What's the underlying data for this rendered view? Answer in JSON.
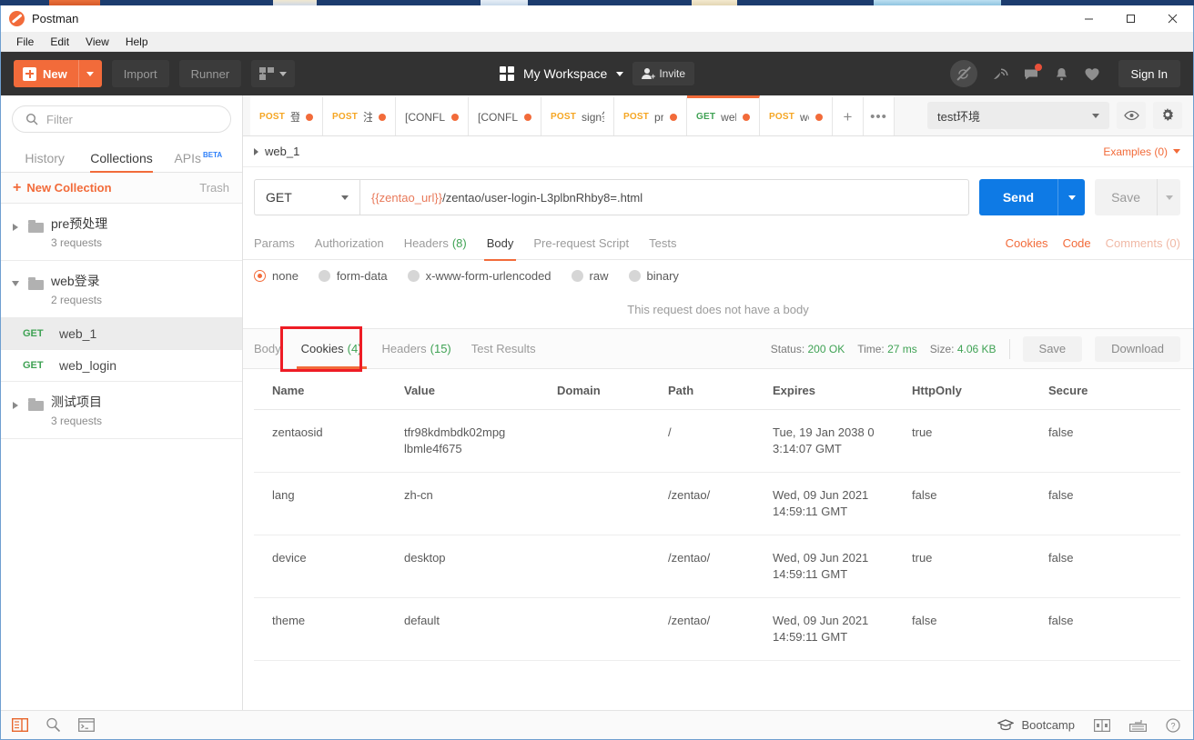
{
  "window": {
    "title": "Postman",
    "controls": {
      "minimize": "minimize-icon",
      "maximize": "maximize-icon",
      "close": "close-icon"
    }
  },
  "menubar": {
    "items": [
      "File",
      "Edit",
      "View",
      "Help"
    ]
  },
  "toolbar": {
    "new_label": "New",
    "import_label": "Import",
    "runner_label": "Runner",
    "workspace_label": "My Workspace",
    "invite_label": "Invite",
    "signin_label": "Sign In",
    "accent": "#f26b3a"
  },
  "sidebar": {
    "filter_placeholder": "Filter",
    "tabs": [
      {
        "label": "History",
        "active": false
      },
      {
        "label": "Collections",
        "active": true
      },
      {
        "label": "APIs",
        "badge": "BETA",
        "active": false
      }
    ],
    "new_collection_label": "New Collection",
    "trash_label": "Trash",
    "collections": [
      {
        "name": "pre预处理",
        "count": "3 requests",
        "expanded": false
      },
      {
        "name": "web登录",
        "count": "2 requests",
        "expanded": true
      },
      {
        "name": "测试项目",
        "count": "3 requests",
        "expanded": false
      }
    ],
    "requests": [
      {
        "method": "GET",
        "name": "web_1",
        "selected": true
      },
      {
        "method": "GET",
        "name": "web_login",
        "selected": false
      }
    ]
  },
  "request_tabs": {
    "items": [
      {
        "method": "POST",
        "name": "登录",
        "dirty": true,
        "active": false
      },
      {
        "method": "POST",
        "name": "注册",
        "dirty": true,
        "active": false
      },
      {
        "method": "",
        "name": "[CONFLIC",
        "dirty": true,
        "active": false
      },
      {
        "method": "",
        "name": "[CONFLIC",
        "dirty": true,
        "active": false
      },
      {
        "method": "POST",
        "name": "sign签名",
        "dirty": false,
        "active": false
      },
      {
        "method": "POST",
        "name": "pre",
        "dirty": true,
        "active": false
      },
      {
        "method": "GET",
        "name": "web_",
        "dirty": true,
        "active": true
      },
      {
        "method": "POST",
        "name": "wet",
        "dirty": true,
        "active": false
      }
    ],
    "add_label": "+",
    "more_label": "•••"
  },
  "environment": {
    "selected": "test环境",
    "eye_icon": "eye-icon",
    "gear_icon": "gear-icon"
  },
  "request": {
    "title": "web_1",
    "examples_label": "Examples (0)",
    "method": "GET",
    "url_variable": "{{zentao_url}}",
    "url_rest": "/zentao/user-login-L3plbnRhby8=.html",
    "send_label": "Send",
    "save_label": "Save",
    "tabs": [
      {
        "label": "Params",
        "count": "",
        "active": false
      },
      {
        "label": "Authorization",
        "count": "",
        "active": false
      },
      {
        "label": "Headers",
        "count": "(8)",
        "active": false
      },
      {
        "label": "Body",
        "count": "",
        "active": true
      },
      {
        "label": "Pre-request Script",
        "count": "",
        "active": false
      },
      {
        "label": "Tests",
        "count": "",
        "active": false
      }
    ],
    "links": [
      {
        "label": "Cookies",
        "muted": false
      },
      {
        "label": "Code",
        "muted": false
      },
      {
        "label": "Comments (0)",
        "muted": true
      }
    ],
    "body_types": [
      {
        "label": "none",
        "selected": true
      },
      {
        "label": "form-data",
        "selected": false
      },
      {
        "label": "x-www-form-urlencoded",
        "selected": false
      },
      {
        "label": "raw",
        "selected": false
      },
      {
        "label": "binary",
        "selected": false
      }
    ],
    "no_body_note": "This request does not have a body"
  },
  "response": {
    "tabs": [
      {
        "label": "Body",
        "count": "",
        "active": false,
        "highlighted": false
      },
      {
        "label": "Cookies",
        "count": "(4)",
        "active": true,
        "highlighted": true
      },
      {
        "label": "Headers",
        "count": "(15)",
        "active": false,
        "highlighted": false
      },
      {
        "label": "Test Results",
        "count": "",
        "active": false,
        "highlighted": false
      }
    ],
    "status_label": "Status:",
    "status_value": "200 OK",
    "time_label": "Time:",
    "time_value": "27 ms",
    "size_label": "Size:",
    "size_value": "4.06 KB",
    "save_label": "Save",
    "download_label": "Download",
    "annotation_color": "#ee1c25"
  },
  "cookies_table": {
    "columns": [
      "Name",
      "Value",
      "Domain",
      "Path",
      "Expires",
      "HttpOnly",
      "Secure"
    ],
    "rows": [
      {
        "name": "zentaosid",
        "value": "tfr98kdmbdk02mpglbmle4f675",
        "domain": "",
        "path": "/",
        "expires": "Tue, 19 Jan 2038 03:14:07 GMT",
        "httponly": "true",
        "secure": "false"
      },
      {
        "name": "lang",
        "value": "zh-cn",
        "domain": "",
        "path": "/zentao/",
        "expires": "Wed, 09 Jun 2021 14:59:11 GMT",
        "httponly": "false",
        "secure": "false"
      },
      {
        "name": "device",
        "value": "desktop",
        "domain": "",
        "path": "/zentao/",
        "expires": "Wed, 09 Jun 2021 14:59:11 GMT",
        "httponly": "true",
        "secure": "false"
      },
      {
        "name": "theme",
        "value": "default",
        "domain": "",
        "path": "/zentao/",
        "expires": "Wed, 09 Jun 2021 14:59:11 GMT",
        "httponly": "false",
        "secure": "false"
      }
    ]
  },
  "footer": {
    "bootcamp_label": "Bootcamp",
    "left_icons": [
      "sidebar-toggle-icon",
      "find-icon",
      "console-icon"
    ],
    "right_icons": [
      "two-pane-icon",
      "keyboard-shortcuts-icon",
      "help-icon"
    ]
  }
}
